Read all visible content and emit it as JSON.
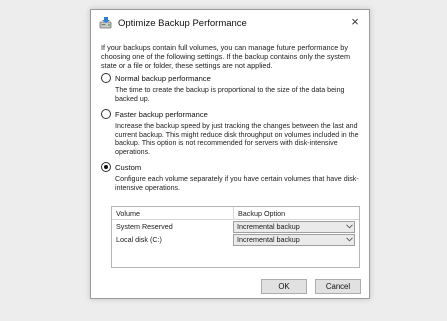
{
  "dialog": {
    "title": "Optimize Backup Performance",
    "close_glyph": "×",
    "icon": "backup-disk-icon",
    "intro": "If your backups contain full volumes, you can manage future performance by choosing one of the following settings. If the backup contains only the system state or a file or folder, these settings are not applied."
  },
  "options": [
    {
      "label": "Normal backup performance",
      "description": "The time to create the backup is proportional to the size of the data being backed up.",
      "checked": false
    },
    {
      "label": "Faster backup performance",
      "description": "Increase the backup speed by just tracking the changes between the last and current backup.  This might reduce disk throughput on volumes included in the backup. This option is not recommended for servers with disk-intensive operations.",
      "checked": false
    },
    {
      "label": "Custom",
      "description": "Configure each volume separately if you have certain volumes that have disk-intensive operations.",
      "checked": true
    }
  ],
  "grid": {
    "headers": [
      "Volume",
      "Backup Option"
    ],
    "rows": [
      {
        "volume": "System Reserved",
        "option": "Incremental backup"
      },
      {
        "volume": "Local disk (C:)",
        "option": "Incremental backup"
      }
    ]
  },
  "buttons": {
    "ok": "OK",
    "cancel": "Cancel"
  },
  "colors": {
    "background": "#ededed",
    "dialog": "#ffffff",
    "button": "#e1e1e1"
  }
}
